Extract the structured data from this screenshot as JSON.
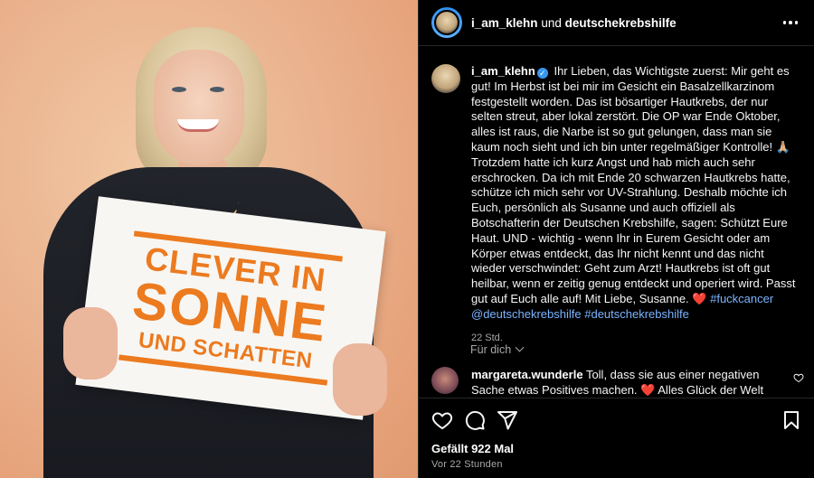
{
  "image": {
    "sign_line1": "CLEVER IN",
    "sign_line2": "SONNE",
    "sign_line3": "UND SCHATTEN"
  },
  "header": {
    "username": "i_am_klehn",
    "joiner": "und",
    "collaborator": "deutschekrebshilfe"
  },
  "caption": {
    "username": "i_am_klehn",
    "verified_icon": "verified-badge-icon",
    "text": "Ihr Lieben, das Wichtigste zuerst: Mir geht es gut! Im Herbst ist bei mir im Gesicht ein Basalzellkarzinom festgestellt worden. Das ist bösartiger Hautkrebs, der nur selten streut, aber lokal zerstört. Die OP war Ende Oktober, alles ist raus, die Narbe ist so gut gelungen, dass man sie kaum noch sieht und ich bin unter regelmäßiger Kontrolle! 🙏🏼",
    "text2": "Trotzdem hatte ich kurz Angst und hab mich auch sehr erschrocken. Da ich mit Ende 20 schwarzen Hautkrebs hatte, schütze ich mich sehr vor UV-Strahlung. Deshalb möchte ich Euch, persönlich als Susanne und auch offiziell als Botschafterin der Deutschen Krebshilfe, sagen: Schützt Eure Haut. UND - wichtig - wenn Ihr in Eurem Gesicht oder am Körper etwas entdeckt, das Ihr nicht kennt und das nicht wieder verschwindet: Geht zum Arzt! Hautkrebs ist oft gut heilbar, wenn er zeitig genug entdeckt und operiert wird. Passt gut auf Euch alle auf! Mit Liebe, Susanne.",
    "heart": "❤️",
    "hashtag1": "#fuckcancer",
    "mention": "@deutschekrebshilfe",
    "hashtag2": "#deutschekrebshilfe",
    "time": "22 Std."
  },
  "for_you": "Für dich",
  "comment": {
    "username": "margareta.wunderle",
    "text": "Toll, dass sie aus einer negativen Sache etwas Positives machen.",
    "heart": "❤️",
    "text2": "Alles Glück der Welt für"
  },
  "actions": {
    "likes": "Gefällt 922 Mal",
    "ago": "Vor 22 Stunden",
    "icons": [
      "heart-icon",
      "comment-icon",
      "share-icon",
      "bookmark-icon"
    ]
  },
  "colors": {
    "sign_orange": "#ec7a1f",
    "link_blue": "#7ab4ff",
    "verified_blue": "#3897f0"
  }
}
